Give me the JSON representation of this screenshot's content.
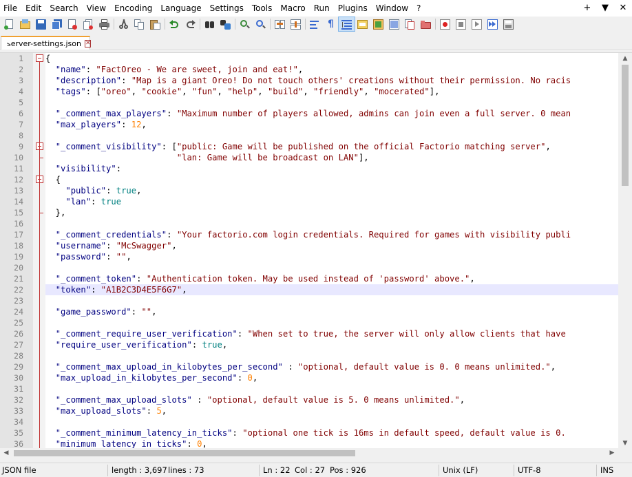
{
  "menu": {
    "items": [
      "File",
      "Edit",
      "Search",
      "View",
      "Encoding",
      "Language",
      "Settings",
      "Tools",
      "Macro",
      "Run",
      "Plugins",
      "Window",
      "?"
    ],
    "right": [
      "+",
      "▼",
      "✕"
    ]
  },
  "toolbar": {
    "icons": [
      "new-file-icon",
      "open-file-icon",
      "save-icon",
      "save-all-icon",
      "close-icon",
      "close-all-icon",
      "print-icon",
      "cut-icon",
      "copy-icon",
      "paste-icon",
      "undo-icon",
      "redo-icon",
      "find-icon",
      "replace-icon",
      "zoom-in-icon",
      "zoom-out-icon",
      "sync-vertical-icon",
      "sync-horizontal-icon",
      "word-wrap-icon",
      "show-all-characters-icon",
      "indent-guide-icon",
      "udl-icon",
      "document-map-icon",
      "function-list-icon",
      "folder-as-workspace-icon",
      "monitoring-icon",
      "record-macro-icon",
      "stop-recording-icon",
      "playback-icon",
      "run-macro-multiple-icon",
      "save-macro-icon"
    ]
  },
  "tab": {
    "label": "server-settings.json",
    "close_symbol": "✕"
  },
  "editor": {
    "current_line": 22,
    "lines": [
      {
        "n": "1",
        "fold": "open-top",
        "t": [
          {
            "c": "p",
            "v": "{"
          }
        ]
      },
      {
        "n": "2",
        "t": [
          {
            "c": "p",
            "v": "  "
          },
          {
            "c": "k",
            "v": "\"name\""
          },
          {
            "c": "p",
            "v": ": "
          },
          {
            "c": "s",
            "v": "\"FactOreo - We are sweet, join and eat!\""
          },
          {
            "c": "p",
            "v": ","
          }
        ]
      },
      {
        "n": "3",
        "t": [
          {
            "c": "p",
            "v": "  "
          },
          {
            "c": "k",
            "v": "\"description\""
          },
          {
            "c": "p",
            "v": ": "
          },
          {
            "c": "s",
            "v": "\"Map is a giant Oreo! Do not touch others' creations without their permission. No racis"
          }
        ]
      },
      {
        "n": "4",
        "t": [
          {
            "c": "p",
            "v": "  "
          },
          {
            "c": "k",
            "v": "\"tags\""
          },
          {
            "c": "p",
            "v": ": ["
          },
          {
            "c": "s",
            "v": "\"oreo\""
          },
          {
            "c": "p",
            "v": ", "
          },
          {
            "c": "s",
            "v": "\"cookie\""
          },
          {
            "c": "p",
            "v": ", "
          },
          {
            "c": "s",
            "v": "\"fun\""
          },
          {
            "c": "p",
            "v": ", "
          },
          {
            "c": "s",
            "v": "\"help\""
          },
          {
            "c": "p",
            "v": ", "
          },
          {
            "c": "s",
            "v": "\"build\""
          },
          {
            "c": "p",
            "v": ", "
          },
          {
            "c": "s",
            "v": "\"friendly\""
          },
          {
            "c": "p",
            "v": ", "
          },
          {
            "c": "s",
            "v": "\"mocerated\""
          },
          {
            "c": "p",
            "v": "],"
          }
        ]
      },
      {
        "n": "5",
        "t": []
      },
      {
        "n": "6",
        "t": [
          {
            "c": "p",
            "v": "  "
          },
          {
            "c": "k",
            "v": "\"_comment_max_players\""
          },
          {
            "c": "p",
            "v": ": "
          },
          {
            "c": "s",
            "v": "\"Maximum number of players allowed, admins can join even a full server. 0 mean"
          }
        ]
      },
      {
        "n": "7",
        "t": [
          {
            "c": "p",
            "v": "  "
          },
          {
            "c": "k",
            "v": "\"max_players\""
          },
          {
            "c": "p",
            "v": ": "
          },
          {
            "c": "n",
            "v": "12"
          },
          {
            "c": "p",
            "v": ","
          }
        ]
      },
      {
        "n": "8",
        "t": []
      },
      {
        "n": "9",
        "fold": "open",
        "t": [
          {
            "c": "p",
            "v": "  "
          },
          {
            "c": "k",
            "v": "\"_comment_visibility\""
          },
          {
            "c": "p",
            "v": ": ["
          },
          {
            "c": "s",
            "v": "\"public: Game will be published on the official Factorio matching server\""
          },
          {
            "c": "p",
            "v": ","
          }
        ]
      },
      {
        "n": "10",
        "fold": "end",
        "t": [
          {
            "c": "p",
            "v": "                          "
          },
          {
            "c": "s",
            "v": "\"lan: Game will be broadcast on LAN\""
          },
          {
            "c": "p",
            "v": "],"
          }
        ]
      },
      {
        "n": "11",
        "t": [
          {
            "c": "p",
            "v": "  "
          },
          {
            "c": "k",
            "v": "\"visibility\""
          },
          {
            "c": "p",
            "v": ":"
          }
        ]
      },
      {
        "n": "12",
        "fold": "open",
        "t": [
          {
            "c": "p",
            "v": "  {"
          }
        ]
      },
      {
        "n": "13",
        "t": [
          {
            "c": "p",
            "v": "    "
          },
          {
            "c": "k",
            "v": "\"public\""
          },
          {
            "c": "p",
            "v": ": "
          },
          {
            "c": "b",
            "v": "true"
          },
          {
            "c": "p",
            "v": ","
          }
        ]
      },
      {
        "n": "14",
        "t": [
          {
            "c": "p",
            "v": "    "
          },
          {
            "c": "k",
            "v": "\"lan\""
          },
          {
            "c": "p",
            "v": ": "
          },
          {
            "c": "b",
            "v": "true"
          }
        ]
      },
      {
        "n": "15",
        "fold": "end",
        "t": [
          {
            "c": "p",
            "v": "  },"
          }
        ]
      },
      {
        "n": "16",
        "t": []
      },
      {
        "n": "17",
        "t": [
          {
            "c": "p",
            "v": "  "
          },
          {
            "c": "k",
            "v": "\"_comment_credentials\""
          },
          {
            "c": "p",
            "v": ": "
          },
          {
            "c": "s",
            "v": "\"Your factorio.com login credentials. Required for games with visibility publi"
          }
        ]
      },
      {
        "n": "18",
        "t": [
          {
            "c": "p",
            "v": "  "
          },
          {
            "c": "k",
            "v": "\"username\""
          },
          {
            "c": "p",
            "v": ": "
          },
          {
            "c": "s",
            "v": "\"McSwagger\""
          },
          {
            "c": "p",
            "v": ","
          }
        ]
      },
      {
        "n": "19",
        "t": [
          {
            "c": "p",
            "v": "  "
          },
          {
            "c": "k",
            "v": "\"password\""
          },
          {
            "c": "p",
            "v": ": "
          },
          {
            "c": "s",
            "v": "\"\""
          },
          {
            "c": "p",
            "v": ","
          }
        ]
      },
      {
        "n": "20",
        "t": []
      },
      {
        "n": "21",
        "t": [
          {
            "c": "p",
            "v": "  "
          },
          {
            "c": "k",
            "v": "\"_comment_token\""
          },
          {
            "c": "p",
            "v": ": "
          },
          {
            "c": "s",
            "v": "\"Authentication token. May be used instead of 'password' above.\""
          },
          {
            "c": "p",
            "v": ","
          }
        ]
      },
      {
        "n": "22",
        "t": [
          {
            "c": "p",
            "v": "  "
          },
          {
            "c": "k",
            "v": "\"token\""
          },
          {
            "c": "p",
            "v": ": "
          },
          {
            "c": "s",
            "v": "\"A1B2C3D4E5F6G7\""
          },
          {
            "c": "p",
            "v": ","
          }
        ]
      },
      {
        "n": "23",
        "t": []
      },
      {
        "n": "24",
        "t": [
          {
            "c": "p",
            "v": "  "
          },
          {
            "c": "k",
            "v": "\"game_password\""
          },
          {
            "c": "p",
            "v": ": "
          },
          {
            "c": "s",
            "v": "\"\""
          },
          {
            "c": "p",
            "v": ","
          }
        ]
      },
      {
        "n": "25",
        "t": []
      },
      {
        "n": "26",
        "t": [
          {
            "c": "p",
            "v": "  "
          },
          {
            "c": "k",
            "v": "\"_comment_require_user_verification\""
          },
          {
            "c": "p",
            "v": ": "
          },
          {
            "c": "s",
            "v": "\"When set to true, the server will only allow clients that have"
          }
        ]
      },
      {
        "n": "27",
        "t": [
          {
            "c": "p",
            "v": "  "
          },
          {
            "c": "k",
            "v": "\"require_user_verification\""
          },
          {
            "c": "p",
            "v": ": "
          },
          {
            "c": "b",
            "v": "true"
          },
          {
            "c": "p",
            "v": ","
          }
        ]
      },
      {
        "n": "28",
        "t": []
      },
      {
        "n": "29",
        "t": [
          {
            "c": "p",
            "v": "  "
          },
          {
            "c": "k",
            "v": "\"_comment_max_upload_in_kilobytes_per_second\""
          },
          {
            "c": "p",
            "v": " : "
          },
          {
            "c": "s",
            "v": "\"optional, default value is 0. 0 means unlimited.\""
          },
          {
            "c": "p",
            "v": ","
          }
        ]
      },
      {
        "n": "30",
        "t": [
          {
            "c": "p",
            "v": "  "
          },
          {
            "c": "k",
            "v": "\"max_upload_in_kilobytes_per_second\""
          },
          {
            "c": "p",
            "v": ": "
          },
          {
            "c": "n",
            "v": "0"
          },
          {
            "c": "p",
            "v": ","
          }
        ]
      },
      {
        "n": "31",
        "t": []
      },
      {
        "n": "32",
        "t": [
          {
            "c": "p",
            "v": "  "
          },
          {
            "c": "k",
            "v": "\"_comment_max_upload_slots\""
          },
          {
            "c": "p",
            "v": " : "
          },
          {
            "c": "s",
            "v": "\"optional, default value is 5. 0 means unlimited.\""
          },
          {
            "c": "p",
            "v": ","
          }
        ]
      },
      {
        "n": "33",
        "t": [
          {
            "c": "p",
            "v": "  "
          },
          {
            "c": "k",
            "v": "\"max_upload_slots\""
          },
          {
            "c": "p",
            "v": ": "
          },
          {
            "c": "n",
            "v": "5"
          },
          {
            "c": "p",
            "v": ","
          }
        ]
      },
      {
        "n": "34",
        "t": []
      },
      {
        "n": "35",
        "t": [
          {
            "c": "p",
            "v": "  "
          },
          {
            "c": "k",
            "v": "\"_comment_minimum_latency_in_ticks\""
          },
          {
            "c": "p",
            "v": ": "
          },
          {
            "c": "s",
            "v": "\"optional one tick is 16ms in default speed, default value is 0."
          }
        ]
      },
      {
        "n": "36",
        "t": [
          {
            "c": "p",
            "v": "  "
          },
          {
            "c": "k",
            "v": "\"minimum_latency_in_ticks\""
          },
          {
            "c": "p",
            "v": ": "
          },
          {
            "c": "n",
            "v": "0"
          },
          {
            "c": "p",
            "v": ","
          }
        ]
      }
    ]
  },
  "status": {
    "file_type": "JSON file",
    "length": "length : 3,697",
    "lines": "lines : 73",
    "ln": "Ln : 22",
    "col": "Col : 27",
    "pos": "Pos : 926",
    "eol": "Unix (LF)",
    "encoding": "UTF-8",
    "mode": "INS"
  },
  "colors": {
    "keyword": "#000080",
    "string": "#800000",
    "number": "#ff8000",
    "boolean": "#008080",
    "fold_marker": "#c03030",
    "current_line": "#e8e8ff"
  }
}
